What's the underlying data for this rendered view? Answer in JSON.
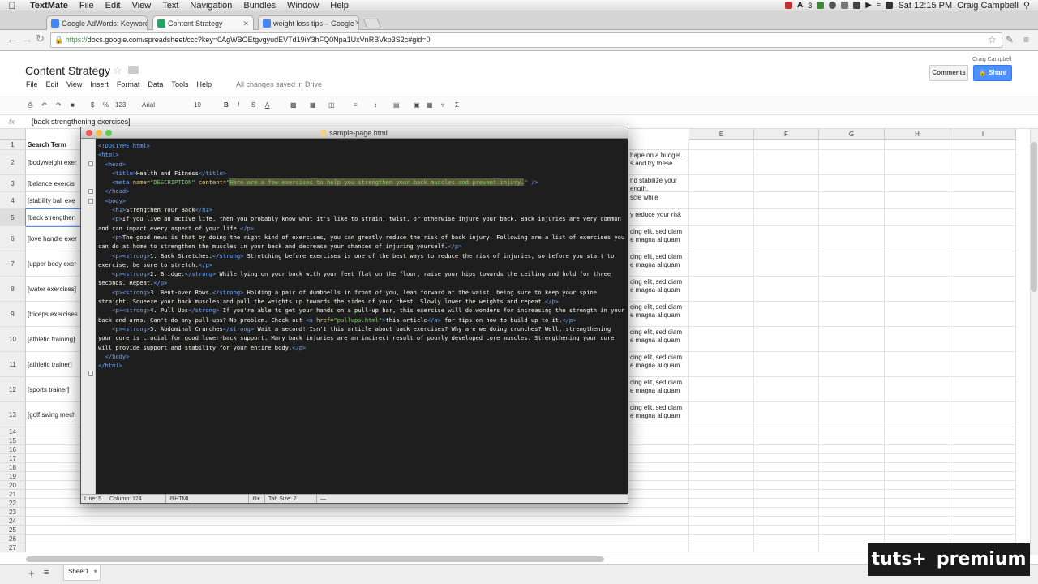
{
  "menubar": {
    "items": [
      "TextMate",
      "File",
      "Edit",
      "View",
      "Text",
      "Navigation",
      "Bundles",
      "Window",
      "Help"
    ],
    "clock": "Sat 12:15 PM",
    "user": "Craig Campbell",
    "status_number": "3"
  },
  "browser": {
    "tabs": [
      {
        "label": "Google AdWords: Keyword"
      },
      {
        "label": "Content Strategy"
      },
      {
        "label": "weight loss tips – Google"
      }
    ],
    "url_prefix": "https://",
    "url_rest": "docs.google.com/spreadsheet/ccc?key=0AgWBOEtgvgyudEVTd19iY3hFQ0Npa1UxVnRBVkp3S2c#gid=0"
  },
  "doc": {
    "title": "Content Strategy",
    "menu": [
      "File",
      "Edit",
      "View",
      "Insert",
      "Format",
      "Data",
      "Tools",
      "Help"
    ],
    "saved_status": "All changes saved in Drive",
    "account": "Craig Campbell",
    "comments_label": "Comments",
    "share_label": "Share"
  },
  "toolbar": {
    "currency": "$",
    "percent": "%",
    "numfmt": "123",
    "font": "Arial",
    "size": "10",
    "bold": "B",
    "italic": "I",
    "strike": "S",
    "textcolor": "A",
    "sum": "Σ"
  },
  "formula": {
    "fx": "fx",
    "value": "[back strengthening exercises]"
  },
  "grid": {
    "columns": [
      "E",
      "F",
      "G",
      "H",
      "I"
    ],
    "row_numbers": [
      "1",
      "2",
      "3",
      "4",
      "5",
      "6",
      "7",
      "8",
      "9",
      "10",
      "11",
      "12",
      "13",
      "14",
      "15",
      "16",
      "17",
      "18",
      "19",
      "20",
      "21",
      "22",
      "23",
      "24",
      "25",
      "26",
      "27"
    ],
    "colA": [
      "Search Term",
      "[bodyweight exer",
      "[balance exercis",
      "[stability ball exe",
      "[back strengthen",
      "[love handle exer",
      "[upper body exer",
      "[water exercises]",
      "[triceps exercises",
      "[athletic training]",
      "[athletic trainer]",
      "[sports trainer]",
      "[golf swing mech"
    ],
    "colD": [
      "",
      "hape on a budget. s and try these",
      "nd stabilize your ength.",
      "scle while",
      "y reduce your risk",
      "cing elit, sed diam e magna aliquam",
      "cing elit, sed diam e magna aliquam",
      "cing elit, sed diam e magna aliquam",
      "cing elit, sed diam e magna aliquam",
      "cing elit, sed diam e magna aliquam",
      "cing elit, sed diam e magna aliquam",
      "cing elit, sed diam e magna aliquam",
      "cing elit, sed diam e magna aliquam"
    ]
  },
  "sheet": {
    "tab_label": "Sheet1"
  },
  "editor": {
    "filename": "sample-page.html",
    "status_line": "Line: 5",
    "status_col": "Column: 124",
    "status_lang": "HTML",
    "status_tab": "Tab Size:  2",
    "status_dash": "—"
  },
  "brand": {
    "left": "tuts+",
    "right": "premium"
  }
}
